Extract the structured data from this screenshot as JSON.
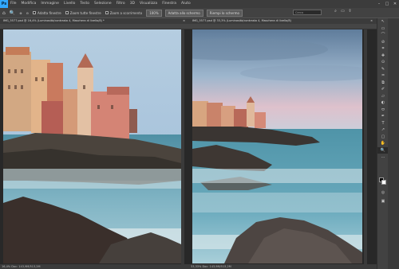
{
  "menu": {
    "logo": "Ps",
    "items": [
      "File",
      "Modifica",
      "Immagine",
      "Livello",
      "Testo",
      "Selezione",
      "Filtro",
      "3D",
      "Visualizza",
      "Finestra",
      "Aiuto"
    ],
    "window_controls": [
      "–",
      "□",
      "✕"
    ]
  },
  "options": {
    "checks": [
      "Adatta finestre",
      "Zoom tutte finestre",
      "Zoom a scorrimento"
    ],
    "zoom_value": "100%",
    "fit_screen": "Adatta allo schermo",
    "fill_screen": "Riempi lo schermo",
    "search_placeholder": "Cerca"
  },
  "docs": [
    {
      "tab": "IMG_5577.psd @ 16,4% (Luminosità/contrasto 4, Maschera di livello/8) *",
      "status": "16,4%   Doc: 143,9M/513,2M"
    },
    {
      "tab": "IMG_5577.psd @ 33,3% (Luminosità/contrasto 4, Maschera di livello/8)",
      "status": "33,33%   Doc: 143,9M/513,2M"
    }
  ],
  "tools": [
    "↖",
    "▭",
    "⌒",
    "⊘",
    "⌗",
    "✚",
    "⊙",
    "✎",
    "♒",
    "⧉",
    "✐",
    "▱",
    "◐",
    "⬭",
    "✒",
    "T",
    "↗",
    "▢",
    "✋",
    "🔍",
    "…"
  ],
  "colors": {
    "fg": "#000000",
    "bg": "#ffffff",
    "accent": "#31a8ff"
  }
}
